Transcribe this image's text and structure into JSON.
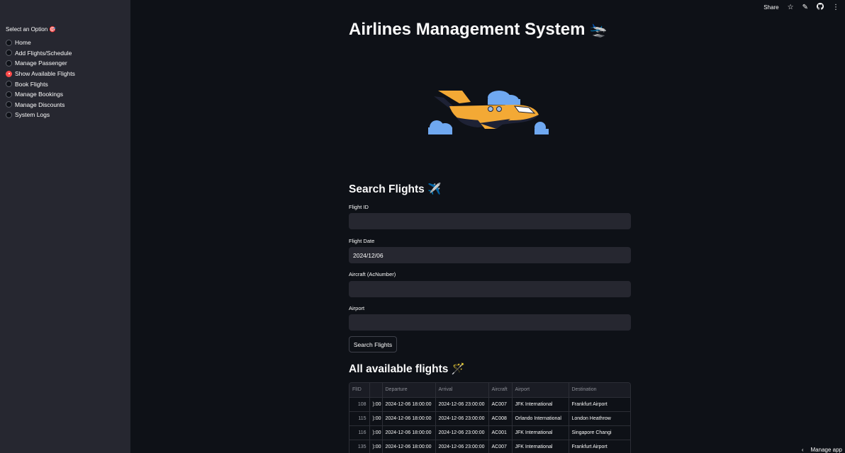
{
  "topbar": {
    "share_label": "Share"
  },
  "sidebar": {
    "label": "Select an Option 🎯",
    "options": [
      {
        "label": "Home",
        "selected": false
      },
      {
        "label": "Add Flights/Schedule",
        "selected": false
      },
      {
        "label": "Manage Passenger",
        "selected": false
      },
      {
        "label": "Show Available Flights",
        "selected": true
      },
      {
        "label": "Book Flights",
        "selected": false
      },
      {
        "label": "Manage Bookings",
        "selected": false
      },
      {
        "label": "Manage Discounts",
        "selected": false
      },
      {
        "label": "System Logs",
        "selected": false
      }
    ]
  },
  "main": {
    "title": "Airlines Management System",
    "title_emoji": "🛬",
    "search_heading": "Search Flights ✈️",
    "fields": {
      "flight_id_label": "Flight ID",
      "flight_id_value": "",
      "flight_date_label": "Flight Date",
      "flight_date_value": "2024/12/06",
      "aircraft_label": "Aircraft (AcNumber)",
      "aircraft_value": "",
      "airport_label": "Airport",
      "airport_value": ""
    },
    "search_button": "Search Flights",
    "results_heading": "All available flights 🪄"
  },
  "table": {
    "columns": [
      "FlID",
      "",
      "Departure",
      "Arrival",
      "Aircraft",
      "Airport",
      "Destination"
    ],
    "rows": [
      [
        "108",
        "):00",
        "2024-12-06 18:00:00",
        "2024-12-06 23:00:00",
        "AC007",
        "JFK International",
        "Frankfurt Airport"
      ],
      [
        "115",
        "):00",
        "2024-12-06 18:00:00",
        "2024-12-06 23:00:00",
        "AC008",
        "Orlando International",
        "London Heathrow"
      ],
      [
        "116",
        "):00",
        "2024-12-06 18:00:00",
        "2024-12-06 23:00:00",
        "AC001",
        "JFK International",
        "Singapore Changi"
      ],
      [
        "135",
        "):00",
        "2024-12-06 18:00:00",
        "2024-12-06 23:00:00",
        "AC007",
        "JFK International",
        "Frankfurt Airport"
      ]
    ]
  },
  "footer": {
    "manage_app": "Manage app"
  }
}
